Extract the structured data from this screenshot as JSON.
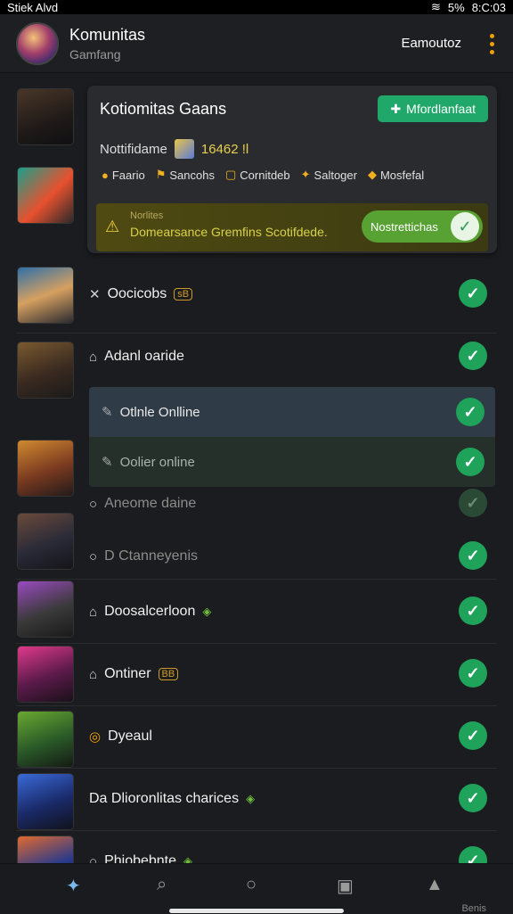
{
  "status_bar": {
    "left": "Stiek Alvd",
    "battery": "5%",
    "time": "8:C:03"
  },
  "header": {
    "title": "Komunitas",
    "subtitle": "Gamfang",
    "action": "Eamoutoz"
  },
  "card": {
    "title": "Kotiomitas Gaans",
    "button": "Mfordlanfaat",
    "meta_label": "Nottifidame",
    "meta_value": "16462 !l",
    "tags": [
      "Faario",
      "Sancohs",
      "Cornitdeb",
      "Saltoger",
      "Mosfefal"
    ],
    "notice_label": "Norlites",
    "notice_text": "Domearsance Gremfins Scotifdede.",
    "notice_button": "Nostrettichas"
  },
  "rows": [
    {
      "label": "Oocicobs",
      "icon": "x",
      "badge": "sB"
    },
    {
      "label": "Adanl oaride",
      "icon": "home",
      "badge": ""
    },
    {
      "label": "Aneome daine",
      "icon": "circle",
      "dim": true
    },
    {
      "label": "D Ctanneyenis",
      "icon": "circle",
      "dim": true
    },
    {
      "label": "Doosalcerloon",
      "icon": "home",
      "gbadge": true
    },
    {
      "label": "Ontiner",
      "icon": "home",
      "badge": "BB"
    },
    {
      "label": "Dyeaul",
      "icon": "coin"
    },
    {
      "label": "Da Dlioronlitas charices",
      "icon": "",
      "gbadge": true
    },
    {
      "label": "Phiobebnte",
      "icon": "circle",
      "gbadge": true
    }
  ],
  "popup": [
    {
      "label": "Otlnle Onlline"
    },
    {
      "label": "Oolier online"
    }
  ],
  "bottom_nav": {
    "label": "Benis"
  },
  "colors": {
    "accent": "#1fa35b",
    "warning": "#f3d23a",
    "menu": "#f0a000"
  }
}
